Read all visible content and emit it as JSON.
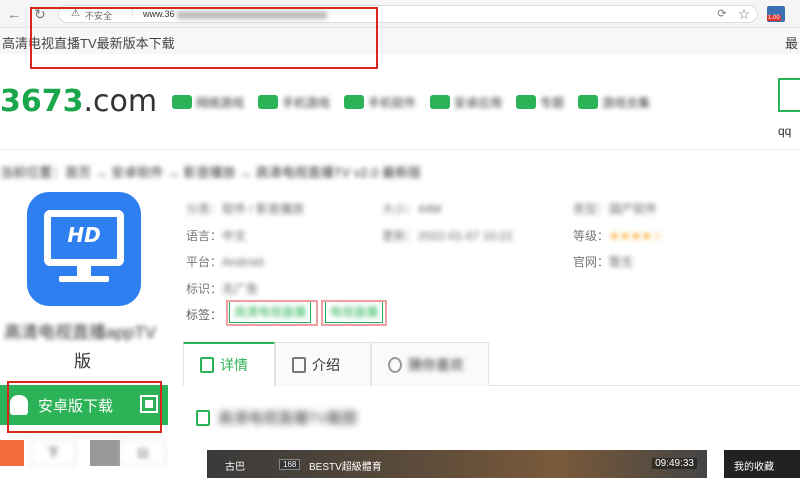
{
  "browser": {
    "insecure_label": "不安全",
    "url": "www.36",
    "page_title": "高清电视直播TV最新版本下载",
    "title_right": "最",
    "ext_badge": "1.00"
  },
  "site": {
    "logo_main": "3673",
    "logo_suffix": ".com",
    "nav": [
      {
        "label": "网络游戏",
        "icon": "gamepad-icon"
      },
      {
        "label": "手机游戏"
      },
      {
        "label": "手机软件"
      },
      {
        "label": "安卓应用"
      },
      {
        "label": "专题"
      },
      {
        "label": "游戏合集"
      }
    ],
    "qq_label": "qq"
  },
  "breadcrumb": "当前位置：首页 → 安卓软件 → 影音播放 → 高清电视直播TV v2.0 最新版",
  "app": {
    "icon_text": "HD",
    "name_line1": "高清电视直播appTV",
    "name_line2": "版"
  },
  "info": {
    "category_key": "分类：",
    "category_val": "软件 / 影音播放",
    "size_key": "大小：",
    "size_val": "44M",
    "type_key": "类型：",
    "type_val": "国产软件",
    "lang_key": "语言：",
    "lang_val": "中文",
    "update_key": "更新：",
    "update_val": "2022-01-07 10:22",
    "level_key": "等级：",
    "level_val": "★★★★☆",
    "platform_key": "平台：",
    "platform_val": "Android",
    "official_key": "官网：",
    "official_val": "暂无",
    "mark_key": "标识：",
    "mark_val": "无广告",
    "tags_key": "标签：",
    "tag1": "高清电视直播",
    "tag2": "电视直播"
  },
  "tabs": [
    {
      "label": "详情"
    },
    {
      "label": "介绍"
    },
    {
      "label": "猜你喜欢"
    }
  ],
  "download": {
    "label": "安卓版下载"
  },
  "mini_buttons": [
    "下",
    "11"
  ],
  "section": {
    "title": "高清电视直播TV截图"
  },
  "banner": {
    "left_text": "古巴",
    "badge": "168",
    "channel": "BESTV超級體育",
    "time": "09:49:33",
    "favorites": "我的收藏"
  }
}
